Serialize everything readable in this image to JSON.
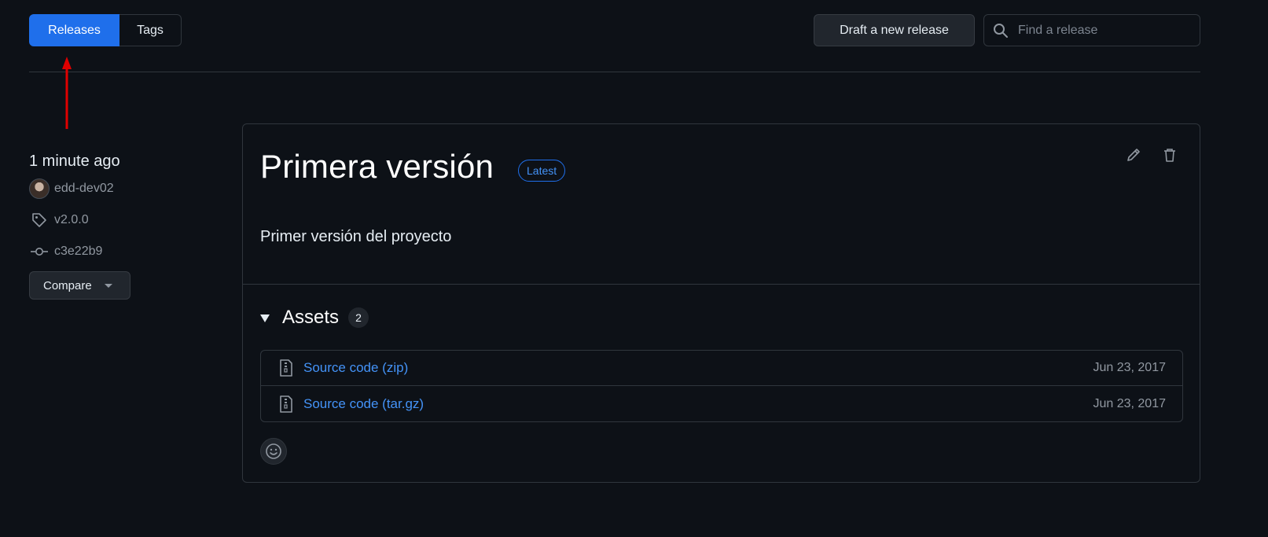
{
  "tabs": {
    "releases": "Releases",
    "tags": "Tags"
  },
  "toolbar": {
    "draft_label": "Draft a new release"
  },
  "search": {
    "placeholder": "Find a release",
    "icon": "search-icon"
  },
  "sidebar": {
    "time": "1 minute ago",
    "author": "edd-dev02",
    "tag": "v2.0.0",
    "commit": "c3e22b9",
    "compare_label": "Compare"
  },
  "release": {
    "title": "Primera versión",
    "badge": "Latest",
    "description": "Primer versión del proyecto",
    "assets_title": "Assets",
    "assets_count": "2",
    "assets": [
      {
        "name": "Source code (zip)",
        "date": "Jun 23, 2017"
      },
      {
        "name": "Source code (tar.gz)",
        "date": "Jun 23, 2017"
      }
    ]
  },
  "colors": {
    "background": "#0d1117",
    "accent": "#1f6feb",
    "link": "#4493f8",
    "annotation_arrow": "#e00000"
  }
}
